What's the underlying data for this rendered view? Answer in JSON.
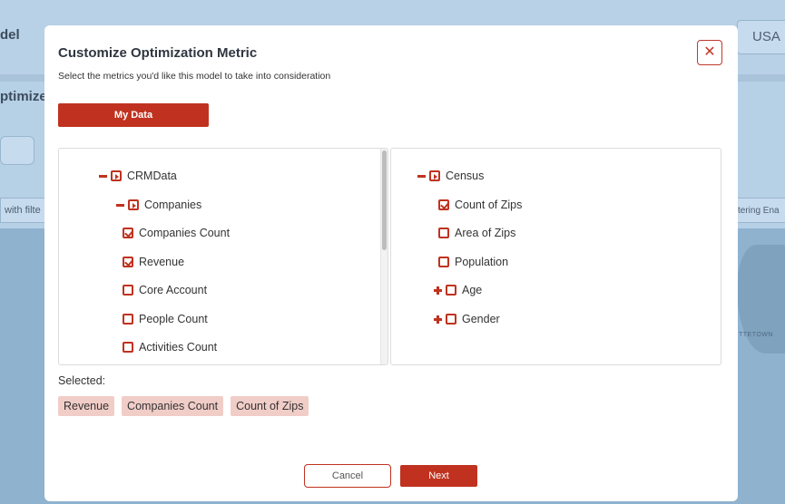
{
  "background": {
    "title_fragment": "del",
    "subtitle_fragment": "ptimize",
    "country_select": "USA",
    "filter_left_fragment": "with filte",
    "filter_right_fragment": "tering Ena",
    "map_label_fragment": "TTETOWN"
  },
  "modal": {
    "title": "Customize Optimization Metric",
    "description": "Select the metrics you'd like this model to take into consideration",
    "close_symbol": "✕",
    "data_source_button": "My Data",
    "left_tree": [
      {
        "label": "CRMData",
        "toggle": "minus",
        "state": "partial",
        "level": 0
      },
      {
        "label": "Companies",
        "toggle": "minus",
        "state": "partial",
        "level": 1
      },
      {
        "label": "Companies Count",
        "toggle": "none",
        "state": "checked",
        "level": 2
      },
      {
        "label": "Revenue",
        "toggle": "none",
        "state": "checked",
        "level": 2
      },
      {
        "label": "Core Account",
        "toggle": "none",
        "state": "unchecked",
        "level": 2
      },
      {
        "label": "People Count",
        "toggle": "none",
        "state": "unchecked",
        "level": 2
      },
      {
        "label": "Activities Count",
        "toggle": "none",
        "state": "unchecked",
        "level": 2
      }
    ],
    "right_tree": [
      {
        "label": "Census",
        "toggle": "minus",
        "state": "partial",
        "level": 0
      },
      {
        "label": "Count of Zips",
        "toggle": "none",
        "state": "checked",
        "level": 1
      },
      {
        "label": "Area of Zips",
        "toggle": "none",
        "state": "unchecked",
        "level": 1
      },
      {
        "label": "Population",
        "toggle": "none",
        "state": "unchecked",
        "level": 1
      },
      {
        "label": "Age",
        "toggle": "plus",
        "state": "unchecked",
        "level": 0
      },
      {
        "label": "Gender",
        "toggle": "plus",
        "state": "unchecked",
        "level": 0
      }
    ],
    "selected_label": "Selected:",
    "selected_items": [
      "Revenue",
      "Companies Count",
      "Count of Zips"
    ],
    "cancel_button": "Cancel",
    "next_button": "Next"
  },
  "colors": {
    "accent": "#c0321f",
    "chip_bg": "#f1cdc8",
    "overlay_bg": "#a9c3da"
  }
}
